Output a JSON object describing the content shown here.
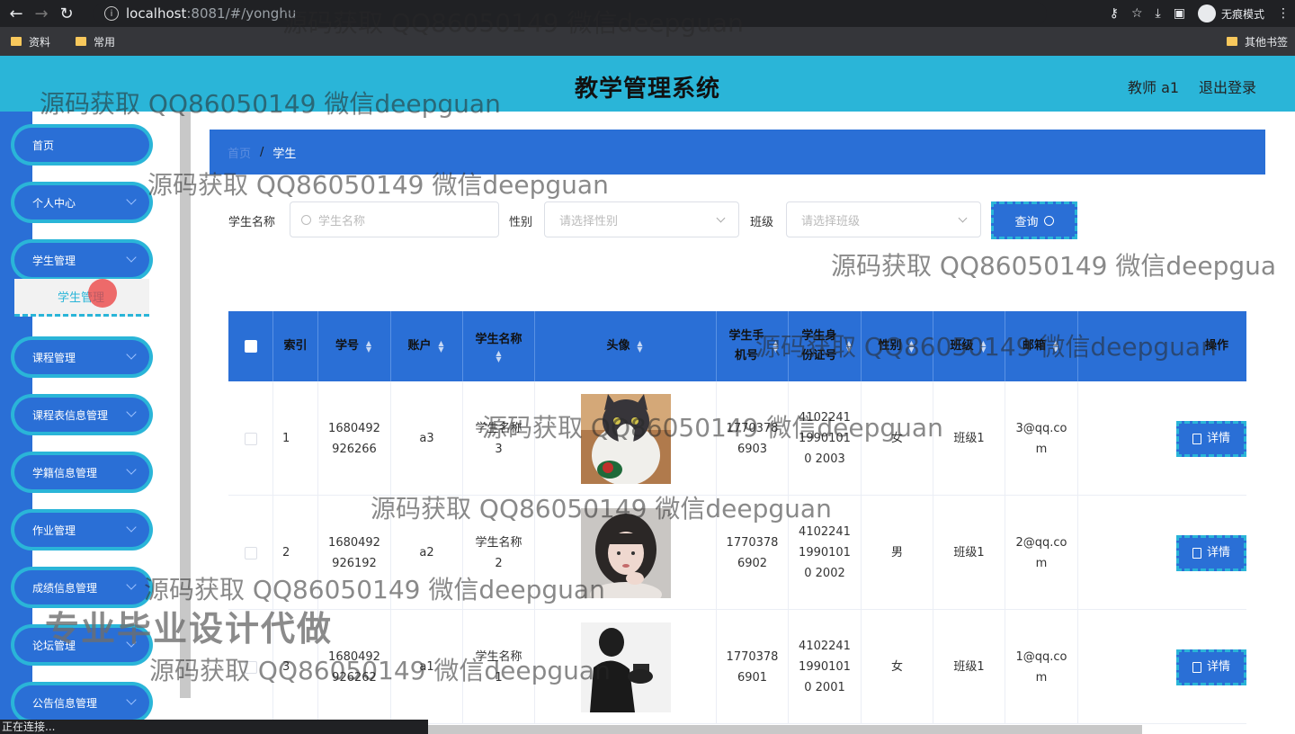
{
  "browser": {
    "url_host": "localhost",
    "url_rest": ":8081/#/yonghu",
    "incognito_label": "无痕模式",
    "bookmarks": [
      "资料",
      "常用"
    ],
    "other_bookmarks": "其他书签",
    "status": "正在连接..."
  },
  "header": {
    "title": "教学管理系统",
    "user": "教师 a1",
    "logout": "退出登录"
  },
  "sidebar": {
    "items": [
      {
        "label": "首页",
        "has_arrow": false
      },
      {
        "label": "个人中心",
        "has_arrow": true
      },
      {
        "label": "学生管理",
        "has_arrow": true
      },
      {
        "label": "课程管理",
        "has_arrow": true
      },
      {
        "label": "课程表信息管理",
        "has_arrow": true
      },
      {
        "label": "学籍信息管理",
        "has_arrow": true
      },
      {
        "label": "作业管理",
        "has_arrow": true
      },
      {
        "label": "成绩信息管理",
        "has_arrow": true
      },
      {
        "label": "论坛管理",
        "has_arrow": true
      },
      {
        "label": "公告信息管理",
        "has_arrow": true
      }
    ],
    "sub_item": "学生管理"
  },
  "breadcrumb": {
    "home": "首页",
    "sep": "/",
    "current": "学生"
  },
  "search": {
    "name_label": "学生名称",
    "name_placeholder": "学生名称",
    "gender_label": "性别",
    "gender_placeholder": "请选择性别",
    "class_label": "班级",
    "class_placeholder": "请选择班级",
    "query_button": "查询"
  },
  "table": {
    "headers": [
      "索引",
      "学号",
      "账户",
      "学生名称",
      "头像",
      "学生手机号",
      "学生身份证号",
      "性别",
      "班级",
      "邮箱",
      "操作"
    ],
    "rows": [
      {
        "index": "1",
        "student_no": "1680492926266",
        "account": "a3",
        "name": "学生名称3",
        "phone": "17703786903",
        "id_card": "410224119901010 2003",
        "gender": "女",
        "class": "班级1",
        "email": "3@qq.com",
        "action": "详情"
      },
      {
        "index": "2",
        "student_no": "1680492926192",
        "account": "a2",
        "name": "学生名称2",
        "phone": "17703786902",
        "id_card": "410224119901010 2002",
        "gender": "男",
        "class": "班级1",
        "email": "2@qq.com",
        "action": "详情"
      },
      {
        "index": "3",
        "student_no": "1680492926262",
        "account": "a1",
        "name": "学生名称1",
        "phone": "17703786901",
        "id_card": "410224119901010 2001",
        "gender": "女",
        "class": "班级1",
        "email": "1@qq.com",
        "action": "详情"
      }
    ]
  },
  "watermark": {
    "text": "源码获取 QQ86050149 微信deepguan",
    "text_cut": "源码获取 QQ86050149 微信deepgua",
    "bold_text": "专业毕业设计代做"
  }
}
